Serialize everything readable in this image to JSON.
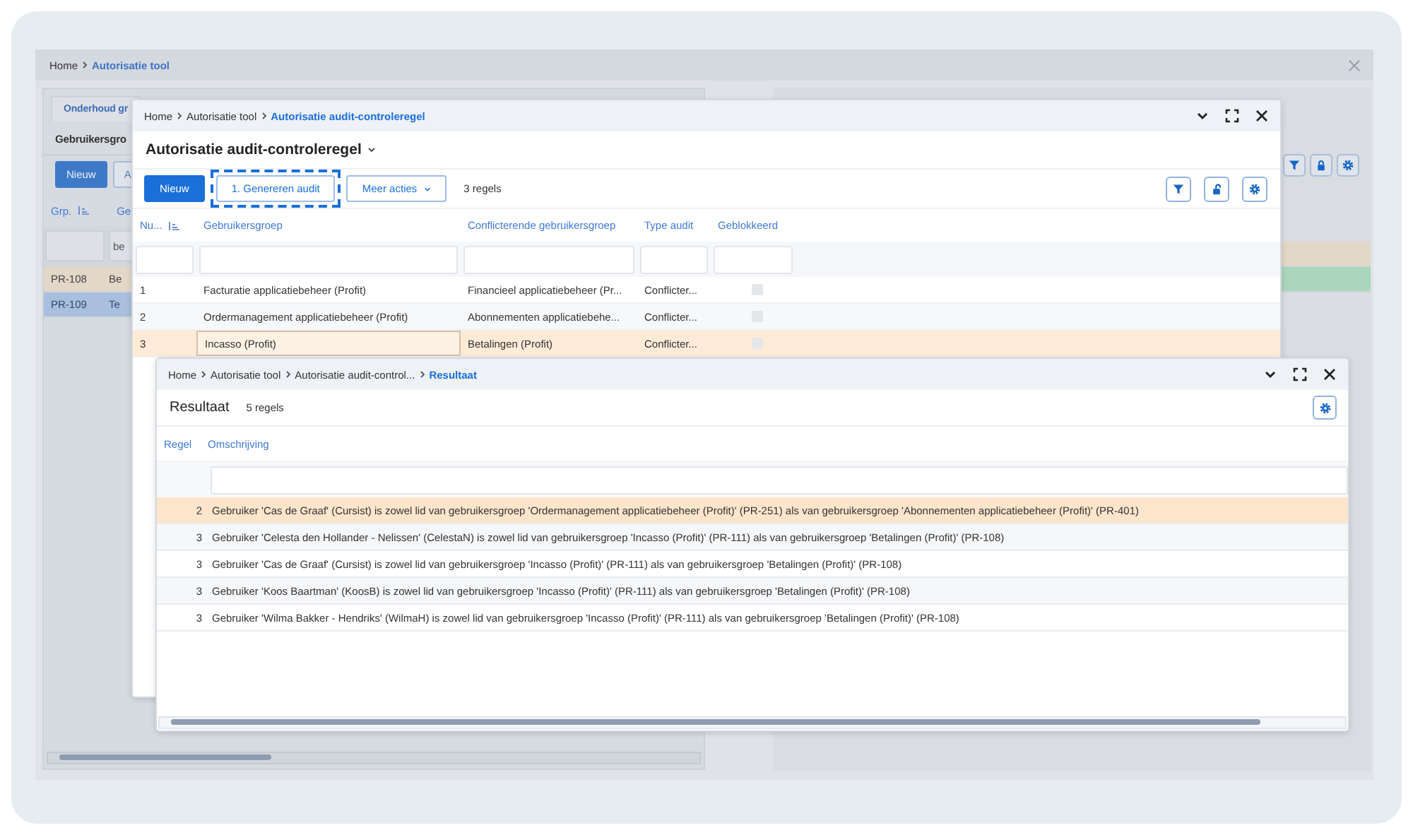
{
  "app": {
    "breadcrumb": [
      {
        "label": "Home",
        "current": false
      },
      {
        "label": "Autorisatie tool",
        "current": true
      }
    ]
  },
  "background": {
    "tab": "Onderhoud gr",
    "title": "Gebruikersgro",
    "buttons": [
      {
        "label": "Nieuw",
        "kind": "primary"
      },
      {
        "label": "A",
        "kind": "secondary"
      }
    ],
    "columns": [
      {
        "label": "Grp.",
        "sorted": true
      },
      {
        "label": "Ge",
        "sorted": false
      }
    ],
    "filter_value": "be",
    "rows": [
      {
        "code": "PR-108",
        "name": "Be",
        "highlighted": true,
        "selected": false
      },
      {
        "code": "PR-109",
        "name": "Te",
        "highlighted": false,
        "selected": true
      }
    ]
  },
  "rule_dialog": {
    "breadcrumb": [
      {
        "label": "Home",
        "current": false
      },
      {
        "label": "Autorisatie tool",
        "current": false
      },
      {
        "label": "Autorisatie audit-controleregel",
        "current": true
      }
    ],
    "title": "Autorisatie audit-controleregel",
    "buttons": [
      {
        "label": "Nieuw",
        "kind": "primary",
        "focused": false
      },
      {
        "label": "1. Genereren audit",
        "kind": "secondary",
        "focused": true
      },
      {
        "label": "Meer acties",
        "kind": "menu",
        "focused": false
      }
    ],
    "count": "3 regels",
    "columns": [
      {
        "label": "Nu...",
        "sorted": true
      },
      {
        "label": "Gebruikersgroep",
        "sorted": false
      },
      {
        "label": "Conflicterende gebruikersgroep",
        "sorted": false
      },
      {
        "label": "Type audit",
        "sorted": false
      },
      {
        "label": "Geblokkeerd",
        "sorted": false
      }
    ],
    "rows": [
      {
        "number": "1",
        "group": "Facturatie applicatiebeheer (Profit)",
        "conflict": "Financieel applicatiebeheer (Pr...",
        "type": "Conflicter...",
        "blocked": false,
        "selected": false
      },
      {
        "number": "2",
        "group": "Ordermanagement applicatiebeheer (Profit)",
        "conflict": "Abonnementen applicatiebehe...",
        "type": "Conflicter...",
        "blocked": false,
        "selected": false
      },
      {
        "number": "3",
        "group": "Incasso (Profit)",
        "conflict": "Betalingen (Profit)",
        "type": "Conflicter...",
        "blocked": false,
        "selected": true
      }
    ]
  },
  "result_dialog": {
    "breadcrumb": [
      {
        "label": "Home",
        "current": false
      },
      {
        "label": "Autorisatie tool",
        "current": false
      },
      {
        "label": "Autorisatie audit-control...",
        "current": false
      },
      {
        "label": "Resultaat",
        "current": true
      }
    ],
    "title": "Resultaat",
    "count": "5 regels",
    "columns": [
      "Regel",
      "Omschrijving"
    ],
    "rows": [
      {
        "regel": "2",
        "text": "Gebruiker 'Cas de Graaf' (Cursist) is zowel lid van gebruikersgroep 'Ordermanagement applicatiebeheer (Profit)' (PR-251) als van gebruikersgroep 'Abonnementen applicatiebeheer (Profit)' (PR-401)",
        "selected": true
      },
      {
        "regel": "3",
        "text": "Gebruiker 'Celesta den Hollander - Nelissen' (CelestaN) is zowel lid van gebruikersgroep 'Incasso (Profit)' (PR-111) als van gebruikersgroep 'Betalingen (Profit)' (PR-108)",
        "selected": false
      },
      {
        "regel": "3",
        "text": "Gebruiker 'Cas de Graaf' (Cursist) is zowel lid van gebruikersgroep 'Incasso (Profit)' (PR-111) als van gebruikersgroep 'Betalingen (Profit)' (PR-108)",
        "selected": false
      },
      {
        "regel": "3",
        "text": "Gebruiker 'Koos Baartman' (KoosB) is zowel lid van gebruikersgroep 'Incasso (Profit)' (PR-111) als van gebruikersgroep 'Betalingen (Profit)' (PR-108)",
        "selected": false
      },
      {
        "regel": "3",
        "text": "Gebruiker 'Wilma Bakker - Hendriks' (WilmaH) is zowel lid van gebruikersgroep 'Incasso (Profit)' (PR-111) als van gebruikersgroep 'Betalingen (Profit)' (PR-108)",
        "selected": false
      }
    ]
  }
}
